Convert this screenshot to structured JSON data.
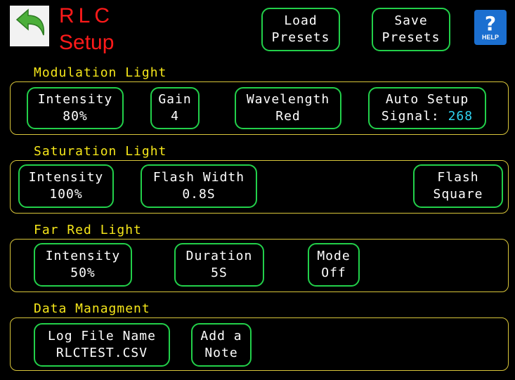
{
  "header": {
    "title_line1": "RLC",
    "title_line2": "Setup",
    "load_line1": "Load",
    "load_line2": "Presets",
    "save_line1": "Save",
    "save_line2": "Presets",
    "help_label": "HELP"
  },
  "modulation": {
    "label": "Modulation Light",
    "intensity_label": "Intensity",
    "intensity_value": "80%",
    "gain_label": "Gain",
    "gain_value": "4",
    "wavelength_label": "Wavelength",
    "wavelength_value": "Red",
    "auto_label": "Auto Setup",
    "signal_label": "Signal:",
    "signal_value": "268"
  },
  "saturation": {
    "label": "Saturation Light",
    "intensity_label": "Intensity",
    "intensity_value": "100%",
    "flash_width_label": "Flash Width",
    "flash_width_value": "0.8S",
    "flash_label": "Flash",
    "flash_value": "Square"
  },
  "far_red": {
    "label": "Far Red Light",
    "intensity_label": "Intensity",
    "intensity_value": "50%",
    "duration_label": "Duration",
    "duration_value": "5S",
    "mode_label": "Mode",
    "mode_value": "Off"
  },
  "data_mgmt": {
    "label": "Data Managment",
    "log_label": "Log File Name",
    "log_value": "RLCTEST.CSV",
    "note_line1": "Add a",
    "note_line2": "Note"
  },
  "colors": {
    "button_border": "#22d04a",
    "section_text": "#f5e61a",
    "title_text": "#ff1a1a",
    "signal_value": "#2fd2f0",
    "help_background": "#1b6fd0",
    "back_arrow": "#4caf3a"
  },
  "icons": {
    "back": "back-arrow-icon",
    "help": "help-question-icon"
  }
}
